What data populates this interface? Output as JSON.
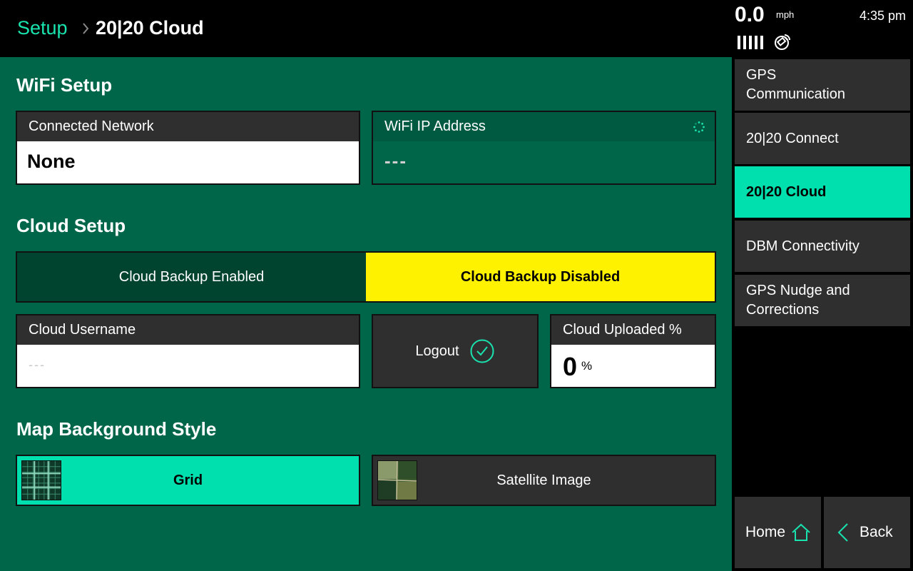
{
  "header": {
    "breadcrumb_parent": "Setup",
    "breadcrumb_current": "20|20 Cloud"
  },
  "status": {
    "speed": "0.0",
    "speed_unit": "mph",
    "time": "4:35 pm",
    "signal_icon": "signal-bars-icon",
    "satellite_icon": "satellite-icon"
  },
  "wifi": {
    "title": "WiFi Setup",
    "connected_network_label": "Connected Network",
    "connected_network_value": "None",
    "ip_label": "WiFi IP Address",
    "ip_value": "---"
  },
  "cloud": {
    "title": "Cloud Setup",
    "backup_enabled_label": "Cloud Backup Enabled",
    "backup_disabled_label": "Cloud Backup Disabled",
    "selected": "Cloud Backup Disabled",
    "username_label": "Cloud Username",
    "username_value": "---",
    "logout_label": "Logout",
    "uploaded_label": "Cloud Uploaded %",
    "uploaded_value": "0",
    "uploaded_unit": "%"
  },
  "map": {
    "title": "Map Background Style",
    "grid_label": "Grid",
    "satellite_label": "Satellite Image",
    "selected": "Grid"
  },
  "sidenav": {
    "items": [
      {
        "label_line1": "GPS",
        "label_line2": "Communication"
      },
      {
        "label": "20|20 Connect"
      },
      {
        "label": "20|20 Cloud",
        "active": true
      },
      {
        "label": "DBM Connectivity"
      },
      {
        "label_line1": "GPS Nudge and",
        "label_line2": "Corrections"
      }
    ],
    "home_label": "Home",
    "back_label": "Back"
  },
  "colors": {
    "accent": "#00e0ae",
    "panel": "#00664a",
    "warning_yellow": "#fff200",
    "button_gray": "#2f2f2f"
  }
}
